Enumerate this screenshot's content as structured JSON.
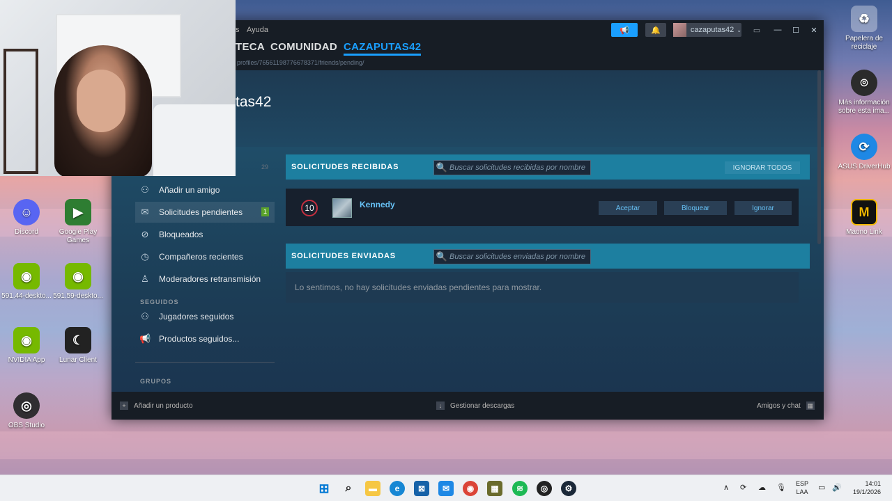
{
  "desktop": {
    "icons_left": [
      {
        "label": "Discord",
        "icon": "discord-icon",
        "color": "#5865f2"
      },
      {
        "label": "Google Play Games",
        "icon": "google-play-games-icon",
        "color": "#2e7d32"
      },
      {
        "label": "591.44-deskto...",
        "icon": "nvidia-installer-icon",
        "color": "#76b900"
      },
      {
        "label": "591.59-deskto...",
        "icon": "nvidia-installer-icon",
        "color": "#76b900"
      },
      {
        "label": "NVIDIA App",
        "icon": "nvidia-app-icon",
        "color": "#76b900"
      },
      {
        "label": "Lunar Client",
        "icon": "lunar-client-icon",
        "color": "#222222"
      },
      {
        "label": "OBS Studio",
        "icon": "obs-studio-icon",
        "color": "#302e31"
      }
    ],
    "icons_right": [
      {
        "label": "Papelera de reciclaje",
        "icon": "recycle-bin-icon"
      },
      {
        "label": "Más información sobre esta ima...",
        "icon": "info-camera-icon"
      },
      {
        "label": "ASUS DriverHub",
        "icon": "asus-driverhub-icon"
      },
      {
        "label": "Maono Link",
        "icon": "maono-link-icon"
      }
    ]
  },
  "steam": {
    "menu": {
      "partial": "s",
      "ayuda": "Ayuda"
    },
    "nav": {
      "biblioteca_partial": "TECA",
      "comunidad": "COMUNIDAD",
      "profile": "CAZAPUTAS42"
    },
    "url": "profiles/76561198776678371/friends/pending/",
    "user": {
      "name": "cazaputas42"
    },
    "profile_name_partial": "tas42",
    "sidebar": {
      "friend_count": "29",
      "items": [
        {
          "label": "Añadir un amigo",
          "icon": "add-person-icon"
        },
        {
          "label": "Solicitudes pendientes",
          "icon": "envelope-icon",
          "badge": "1"
        },
        {
          "label": "Bloqueados",
          "icon": "blocked-icon"
        },
        {
          "label": "Compañeros recientes",
          "icon": "clock-icon"
        },
        {
          "label": "Moderadores retransmisión",
          "icon": "person-icon"
        }
      ],
      "seguidos_label": "SEGUIDOS",
      "seguidos": [
        {
          "label": "Jugadores seguidos",
          "icon": "follow-person-icon"
        },
        {
          "label": "Productos seguidos...",
          "icon": "megaphone-icon"
        }
      ],
      "grupos_label": "GRUPOS"
    },
    "received": {
      "title": "SOLICITUDES RECIBIDAS",
      "search_placeholder": "Buscar solicitudes recibidas por nombre",
      "ignore_all": "IGNORAR TODOS",
      "request": {
        "level": "10",
        "name": "Kennedy",
        "accept": "Aceptar",
        "block": "Bloquear",
        "ignore": "Ignorar"
      }
    },
    "sent": {
      "title": "SOLICITUDES ENVIADAS",
      "search_placeholder": "Buscar solicitudes enviadas por nombre",
      "empty": "Lo sentimos, no hay solicitudes enviadas pendientes para mostrar."
    },
    "footer": {
      "add_product": "Añadir un producto",
      "downloads": "Gestionar descargas",
      "friends_chat": "Amigos y chat"
    }
  },
  "taskbar": {
    "lang_top": "ESP",
    "lang_bottom": "LAA",
    "time": "14:01",
    "date": "19/1/2026"
  }
}
